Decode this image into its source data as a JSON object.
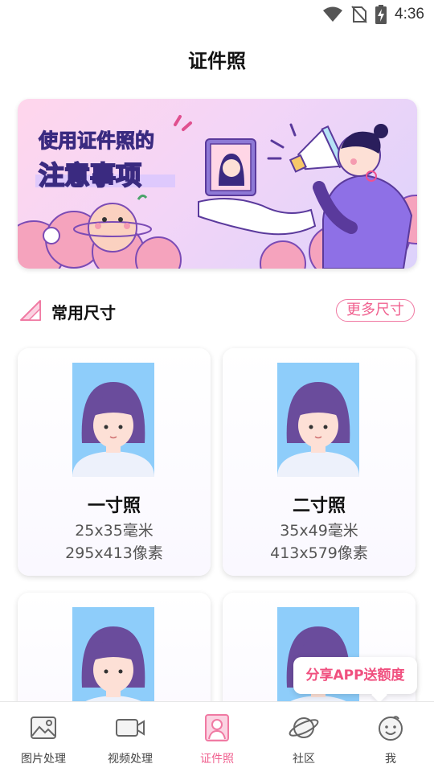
{
  "status_bar": {
    "time": "4:36",
    "icons": [
      "wifi-icon",
      "no-sim-icon",
      "battery-charging-icon"
    ]
  },
  "header": {
    "title": "证件照"
  },
  "banner": {
    "line1": "使用证件照的",
    "line2": "注意事项"
  },
  "section": {
    "title": "常用尺寸",
    "more_label": "更多尺寸",
    "icon": "ruler-triangle-icon"
  },
  "cards": [
    {
      "name": "一寸照",
      "mm": "25x35毫米",
      "px": "295x413像素"
    },
    {
      "name": "二寸照",
      "mm": "35x49毫米",
      "px": "413x579像素"
    },
    {
      "name": "",
      "mm": "",
      "px": ""
    },
    {
      "name": "",
      "mm": "",
      "px": ""
    }
  ],
  "share_bubble": {
    "label": "分享APP送额度"
  },
  "tab_bar": {
    "items": [
      {
        "label": "图片处理",
        "icon": "image-icon"
      },
      {
        "label": "视频处理",
        "icon": "video-camera-icon"
      },
      {
        "label": "证件照",
        "icon": "id-photo-icon",
        "active": true
      },
      {
        "label": "社区",
        "icon": "planet-icon"
      },
      {
        "label": "我",
        "icon": "smiley-face-icon"
      }
    ]
  },
  "colors": {
    "accent": "#f0608f",
    "portrait_bg": "#8ecdfa",
    "hair": "#6a4c9c"
  }
}
